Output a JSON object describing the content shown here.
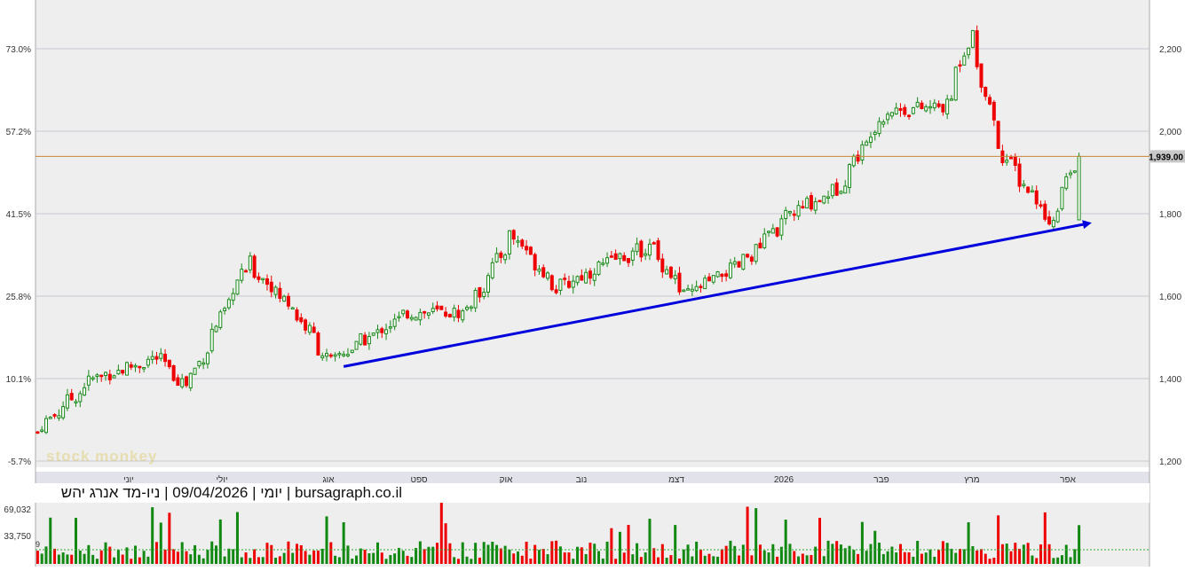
{
  "title": "יומי | 09/04/2026 | ניו-מד אנרג יהש | bursagraph.co.il",
  "watermark": "stock monkey",
  "colors": {
    "up": "#1a8a1a",
    "down": "#ee0000",
    "trendline": "#0000dd",
    "price_line": "#c8863a",
    "grid": "#c8c8d0",
    "panel_bg": "#eeeeee",
    "vol_up": "#118811",
    "vol_down": "#ee0000"
  },
  "chart_data": [
    {
      "type": "candlestick",
      "frequency": "daily",
      "y_right_ticks": [
        "2,200",
        "2,000",
        "1,800",
        "1,600",
        "1,400",
        "1,200"
      ],
      "y_right_values": [
        2200,
        2000,
        1800,
        1600,
        1400,
        1200
      ],
      "y_left_ticks": [
        "73.0%",
        "57.2%",
        "41.5%",
        "25.8%",
        "10.1%",
        "-5.7%"
      ],
      "ylim": [
        1200,
        2200
      ],
      "x_month_labels": [
        "יוני",
        "יולי",
        "אוג",
        "ספט",
        "אוק",
        "נוב",
        "דצמ",
        "2026",
        "פבר",
        "מרץ",
        "אפר"
      ],
      "current_price": 1939.0,
      "current_price_label": "1,939.00",
      "series": [
        {
          "name": "close",
          "key_points": [
            {
              "date": "2025-05-01",
              "value": 1270
            },
            {
              "date": "2025-05-20",
              "value": 1400
            },
            {
              "date": "2025-06-10",
              "value": 1450
            },
            {
              "date": "2025-06-20",
              "value": 1380
            },
            {
              "date": "2025-07-10",
              "value": 1680
            },
            {
              "date": "2025-07-25",
              "value": 1570
            },
            {
              "date": "2025-08-06",
              "value": 1440
            },
            {
              "date": "2025-09-01",
              "value": 1560
            },
            {
              "date": "2025-09-20",
              "value": 1560
            },
            {
              "date": "2025-10-05",
              "value": 1750
            },
            {
              "date": "2025-10-20",
              "value": 1620
            },
            {
              "date": "2025-11-05",
              "value": 1680
            },
            {
              "date": "2025-11-20",
              "value": 1720
            },
            {
              "date": "2025-12-01",
              "value": 1600
            },
            {
              "date": "2025-12-20",
              "value": 1680
            },
            {
              "date": "2026-01-05",
              "value": 1800
            },
            {
              "date": "2026-01-20",
              "value": 1860
            },
            {
              "date": "2026-02-05",
              "value": 2050
            },
            {
              "date": "2026-02-25",
              "value": 2060
            },
            {
              "date": "2026-03-05",
              "value": 2240
            },
            {
              "date": "2026-03-15",
              "value": 1950
            },
            {
              "date": "2026-04-01",
              "value": 1780
            },
            {
              "date": "2026-04-09",
              "value": 1939
            }
          ]
        }
      ],
      "trendline": {
        "start": {
          "date": "2025-08-06",
          "value": 1440
        },
        "end": {
          "date": "2026-04-09",
          "value": 1772
        }
      }
    },
    {
      "type": "bar",
      "name": "volume",
      "y_ticks": [
        "69,032",
        "33,750"
      ],
      "y_values": [
        69032,
        33750
      ],
      "avg_label": "9",
      "ylim": [
        0,
        90000
      ]
    }
  ]
}
